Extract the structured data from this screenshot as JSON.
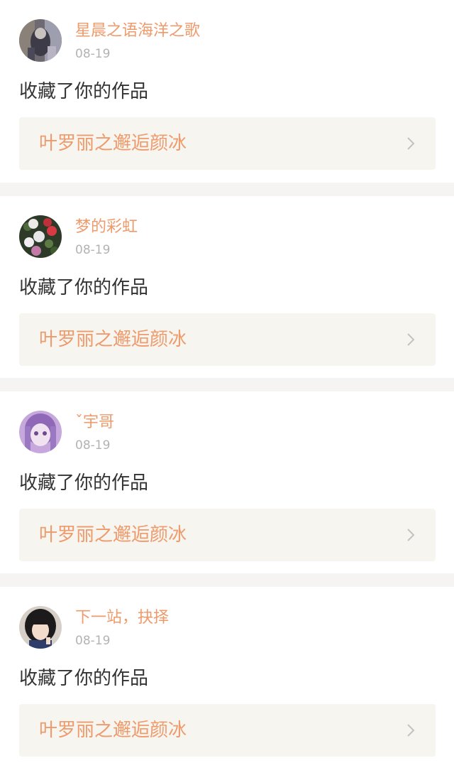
{
  "notifications": [
    {
      "username": "星晨之语海洋之歌",
      "date": "08-19",
      "action": "收藏了你的作品",
      "work_title": "叶罗丽之邂逅颜冰",
      "avatar_icon": "photo-avatar-icon"
    },
    {
      "username": "梦的彩虹",
      "date": "08-19",
      "action": "收藏了你的作品",
      "work_title": "叶罗丽之邂逅颜冰",
      "avatar_icon": "flower-avatar-icon"
    },
    {
      "username": "ˇ宇哥",
      "date": "08-19",
      "action": "收藏了你的作品",
      "work_title": "叶罗丽之邂逅颜冰",
      "avatar_icon": "anime-avatar-icon"
    },
    {
      "username": "下一站，抉择",
      "date": "08-19",
      "action": "收藏了你的作品",
      "work_title": "叶罗丽之邂逅颜冰",
      "avatar_icon": "girl-avatar-icon"
    }
  ],
  "colors": {
    "accent": "#ef9a6b",
    "date": "#b3b3b3",
    "text": "#333333",
    "card_link_bg": "#f6f5f0",
    "separator": "#f5f4f2"
  }
}
